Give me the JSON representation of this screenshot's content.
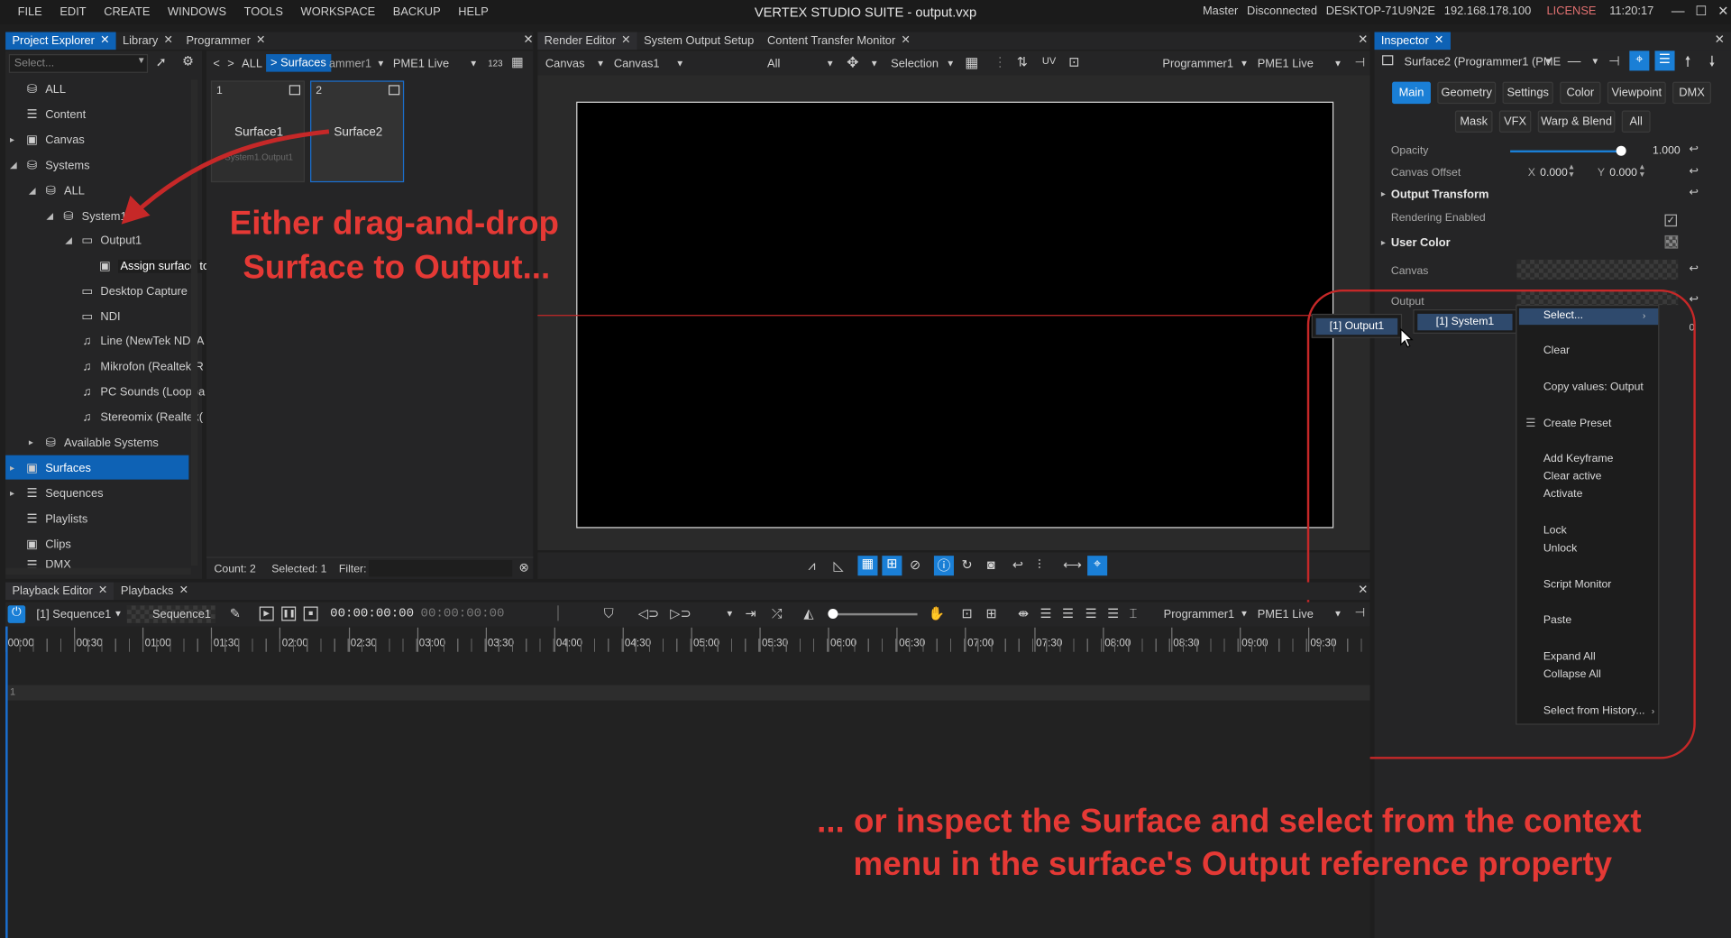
{
  "menu": [
    "FILE",
    "EDIT",
    "CREATE",
    "WINDOWS",
    "TOOLS",
    "WORKSPACE",
    "BACKUP",
    "HELP"
  ],
  "title": "VERTEX STUDIO SUITE - output.vxp",
  "status": {
    "role": "Master",
    "conn": "Disconnected",
    "host": "DESKTOP-71U9N2E",
    "ip": "192.168.178.100",
    "license": "LICENSE",
    "time": "11:20:17"
  },
  "left_tabs": {
    "t1": "Project Explorer",
    "t2": "Library",
    "t3": "Programmer"
  },
  "search_placeholder": "Select...",
  "tree": [
    "ALL",
    "Content",
    "Canvas",
    "Systems",
    "ALL",
    "System1",
    "Output1",
    "Assign surface to output.",
    "Desktop Capture",
    "NDI",
    "Line (NewTek NDI A",
    "Mikrofon (Realtek(R",
    "PC Sounds (Loopba",
    "Stereomix (Realtek(",
    "Available Systems",
    "Surfaces",
    "Sequences",
    "Playlists",
    "Clips",
    "DMX"
  ],
  "surfaces_toolbar": {
    "all": "ALL",
    "crumb": "> Surfaces",
    "prog": "ammer1",
    "pme": "PME1 Live",
    "num": "123"
  },
  "cards": [
    {
      "index": "1",
      "name": "Surface1",
      "sub": "System1.Output1"
    },
    {
      "index": "2",
      "name": "Surface2",
      "sub": ""
    }
  ],
  "surfaces_status": {
    "count": "Count: 2",
    "selected": "Selected: 1",
    "filter": "Filter:"
  },
  "render_tabs": {
    "t1": "Render Editor",
    "t2": "System Output Setup",
    "t3": "Content Transfer Monitor"
  },
  "render_toolbar": {
    "canvas": "Canvas",
    "canvas1": "Canvas1",
    "all": "All",
    "selection": "Selection",
    "prog": "Programmer1",
    "pme": "PME1 Live"
  },
  "inspector": {
    "tab": "Inspector",
    "object": "Surface2 (Programmer1 (PME",
    "tabs_row1": [
      "Main",
      "Geometry",
      "Settings",
      "Color",
      "Viewpoint",
      "DMX"
    ],
    "tabs_row2": [
      "Mask",
      "VFX",
      "Warp & Blend",
      "All"
    ],
    "opacity_label": "Opacity",
    "opacity_value": "1.000",
    "opacity_fraction": 1.0,
    "canvas_offset_label": "Canvas Offset",
    "x_label": "X",
    "x_value": "0.000",
    "y_label": "Y",
    "y_value": "0.000",
    "output_transform": "Output Transform",
    "rendering_enabled": "Rendering Enabled",
    "user_color": "User Color",
    "canvas_label": "Canvas",
    "output_label": "Output"
  },
  "submenu": {
    "output1": "[1] Output1",
    "system1": "[1] System1"
  },
  "context_menu": [
    "Select...",
    "Clear",
    "Copy values: Output",
    "Create Preset",
    "Add Keyframe",
    "Clear active",
    "Activate",
    "Lock",
    "Unlock",
    "Script Monitor",
    "Paste",
    "Expand All",
    "Collapse All",
    "Select from History..."
  ],
  "playback": {
    "tab1": "Playback Editor",
    "tab2": "Playbacks",
    "sequence": "[1] Sequence1",
    "sequence_name": "Sequence1",
    "time1": "00:00:00:00",
    "time2": "00:00:00:00",
    "prog": "Programmer1",
    "pme": "PME1 Live",
    "ticks": [
      "00:00",
      "00:30",
      "01:00",
      "01:30",
      "02:00",
      "02:30",
      "03:00",
      "03:30",
      "04:00",
      "04:30",
      "05:00",
      "05:30",
      "06:00",
      "06:30",
      "07:00",
      "07:30",
      "08:00",
      "08:30",
      "09:00",
      "09:30"
    ],
    "track": "1"
  },
  "annotations": {
    "a1": "Either drag-and-drop",
    "a2": "Surface to Output...",
    "a3": "... or inspect the Surface and select from the context",
    "a4": "menu in the surface's Output reference property"
  },
  "accent": "#0e62b5",
  "annotation_color": "#e53935"
}
